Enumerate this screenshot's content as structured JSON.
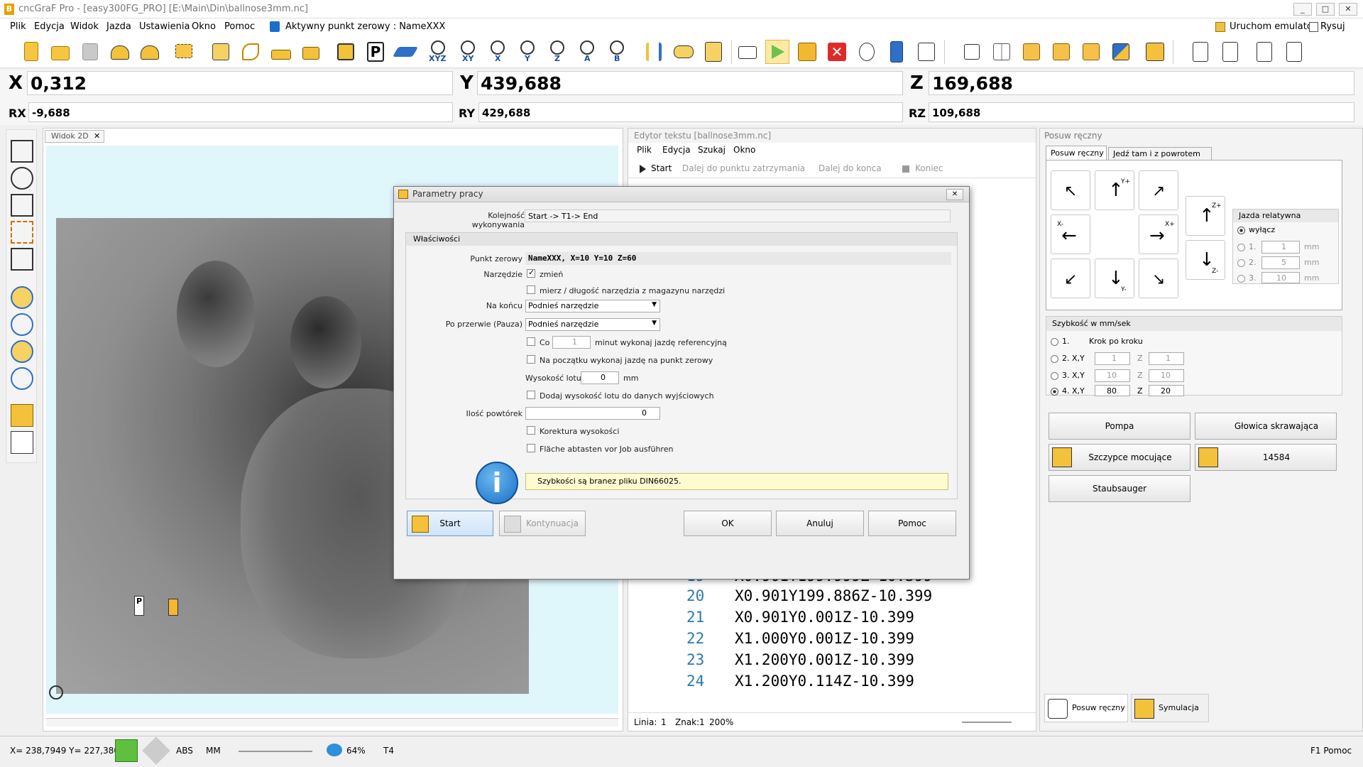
{
  "app": {
    "title": "cncGraF Pro - [easy300FG_PRO] [E:\\Main\\Din\\ballnose3mm.nc]",
    "logo": "B"
  },
  "menu": {
    "items": [
      "Plik",
      "Edycja",
      "Widok",
      "Jazda",
      "Ustawienia",
      "Okno",
      "Pomoc"
    ],
    "active_zero": "Aktywny punkt zerowy : NameXXX",
    "emulator": "Uruchom emulator",
    "draw": "Rysuj"
  },
  "window_buttons": [
    "_",
    "□",
    "✕"
  ],
  "coords": {
    "x_label": "X",
    "x": "0,312",
    "y_label": "Y",
    "y": "439,688",
    "z_label": "Z",
    "z": "169,688",
    "rx_label": "RX",
    "rx": "-9,688",
    "ry_label": "RY",
    "ry": "429,688",
    "rz_label": "RZ",
    "rz": "109,688"
  },
  "toolbar_axis_labels": [
    "XYZ",
    "XY",
    "X",
    "Y",
    "Z",
    "A",
    "B"
  ],
  "view": {
    "tab": "Widok 2D",
    "close": "✕",
    "marker_p": "P"
  },
  "editor": {
    "title": "Edytor tekstu [ballnose3mm.nc]",
    "menu": [
      "Plik",
      "Edycja",
      "Szukaj",
      "Okno"
    ],
    "start": "Start",
    "next_stop": "Dalej do punktu zatrzymania",
    "to_end": "Dalej do konca",
    "end": "Koniec",
    "partial_a": "0",
    "partial_b": "0",
    "lines": [
      {
        "n": "20",
        "code": "X0.901Y199.886Z-10.399"
      },
      {
        "n": "21",
        "code": "X0.901Y0.001Z-10.399"
      },
      {
        "n": "22",
        "code": "X1.000Y0.001Z-10.399"
      },
      {
        "n": "23",
        "code": "X1.200Y0.001Z-10.399"
      },
      {
        "n": "24",
        "code": "X1.200Y0.114Z-10.399"
      }
    ],
    "partial_line": {
      "n": "19",
      "code": "X0.901Y199.999Z-10.399"
    },
    "status": {
      "line_label": "Linia:",
      "line": "1",
      "char_label": "Znak:",
      "char": "1",
      "zoom": "200%"
    }
  },
  "manual": {
    "title": "Posuw ręczny",
    "tabs": [
      "Posuw ręczny",
      "Jedź tam i z powrotem"
    ],
    "relative": {
      "title": "Jazda relatywna",
      "off": "wyłącz",
      "opts": [
        {
          "n": "1.",
          "v": "1",
          "u": "mm"
        },
        {
          "n": "2.",
          "v": "5",
          "u": "mm"
        },
        {
          "n": "3.",
          "v": "10",
          "u": "mm"
        }
      ]
    },
    "speed": {
      "title": "Szybkość w mm/sek",
      "step": "Krok po kroku",
      "rows": [
        {
          "n": "1."
        },
        {
          "n": "2. X,Y",
          "xy": "1",
          "zl": "Z",
          "z": "1"
        },
        {
          "n": "3. X,Y",
          "xy": "10",
          "zl": "Z",
          "z": "10"
        },
        {
          "n": "4. X,Y",
          "xy": "80",
          "zl": "Z",
          "z": "20"
        }
      ]
    },
    "buttons": {
      "pump": "Pompa",
      "spindle": "Głowica skrawająca",
      "clamp": "Szczypce mocujące",
      "rpm": "14584",
      "vacuum": "Staubsauger"
    },
    "bottom": {
      "manual": "Posuw ręczny",
      "sim": "Symulacja"
    },
    "arrow_labels": {
      "yp": "Y+",
      "xm": "X-",
      "xp": "X+",
      "ym": "Y-",
      "zp": "Z+",
      "zm": "Z-"
    }
  },
  "dialog": {
    "title": "Parametry pracy",
    "close": "✕",
    "order_label": "Kolejność wykonywania",
    "order": "Start  -> T1-> End",
    "props": "Właściwości",
    "zero_label": "Punkt zerowy",
    "zero": "NameXXX, X=10 Y=10 Z=60",
    "tool_label": "Narzędzie",
    "change": "zmień",
    "measure": "mierz / długość narzędzia z magazynu narzędzi",
    "at_end_label": "Na końcu",
    "at_end": "Podnieś narzędzie",
    "pause_label": "Po przerwie (Pauza)",
    "pause": "Podnieś narzędzie",
    "every": "Co",
    "every_val": "1",
    "every_text": "minut wykonaj jazdę referencyjną",
    "start_zero": "Na początku wykonaj jazdę na punkt zerowy",
    "height_label": "Wysokość lotu",
    "height": "0",
    "height_unit": "mm",
    "add_height": "Dodaj wysokość lotu do danych wyjściowych",
    "repeat_label": "Ilość powtórek",
    "repeat": "0",
    "height_corr": "Korektura wysokości",
    "scan": "Fläche abtasten vor Job ausführen",
    "info": "Szybkości są branez pliku DIN66025.",
    "start": "Start",
    "continue": "Kontynuacja",
    "ok": "OK",
    "cancel": "Anuluj",
    "help": "Pomoc"
  },
  "status": {
    "pos": "X= 238,7949 Y= 227,3808",
    "abs": "ABS",
    "mm": "MM",
    "zoom": "64%",
    "tool": "T4",
    "help": "F1 Pomoc"
  }
}
